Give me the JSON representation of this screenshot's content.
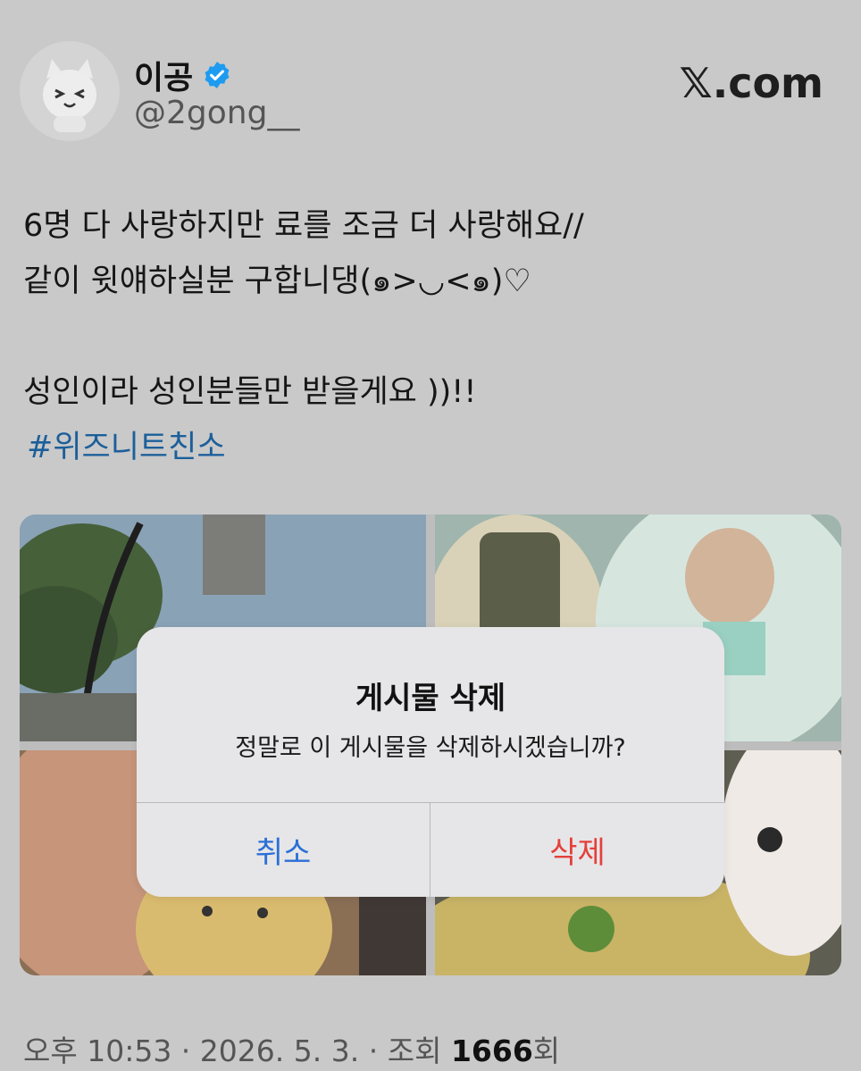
{
  "profile": {
    "name": "이공",
    "handle": "@2gong__"
  },
  "brand": "𝕏.com",
  "tweet": {
    "lines": [
      "6명 다 사랑하지만 료를 조금 더 사랑해요//",
      "같이 윗얘하실분 구합니댕(๑>◡<๑)♡",
      "성인이라 성인분들만 받을게요 ))!!"
    ],
    "hashtag": "#위즈니트친소"
  },
  "dialog": {
    "title": "게시물 삭제",
    "message": "정말로 이 게시물을 삭제하시겠습니까?",
    "cancel_label": "취소",
    "delete_label": "삭제"
  },
  "meta": {
    "time": "오후 10:53",
    "sep1": " · ",
    "date": "2026. 5. 3.",
    "sep2": " · ",
    "views_label": "조회 ",
    "views": "1666",
    "views_unit": "회"
  },
  "colors": {
    "link": "#1c5f9a",
    "cancel": "#2a6fd6",
    "delete": "#e5403b",
    "verified": "#1d9bf0"
  }
}
